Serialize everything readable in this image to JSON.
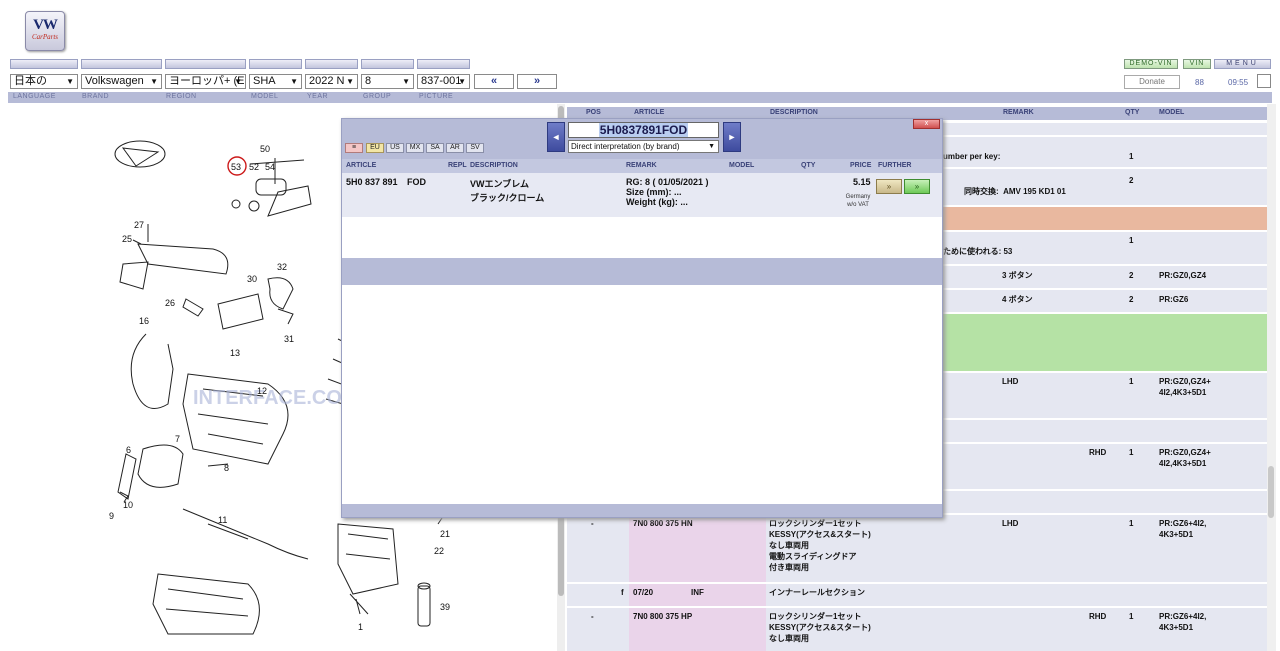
{
  "header": {
    "logo_text": "VW",
    "logo_subtext": "CarParts",
    "demo_vin_label": "DEMO-VIN",
    "vin_label": "VIN",
    "menu_label": "MENU",
    "donate_label": "Donate",
    "counter": "88",
    "time": "09:55"
  },
  "selectors": {
    "language": "日本の",
    "brand": "Volkswagen",
    "region": "ヨーロッパ+ (E",
    "model": "SHA",
    "year": "2022 N",
    "group": "8",
    "picture": "837-001",
    "prev": "«",
    "next": "»"
  },
  "labels": {
    "language": "LANGUAGE",
    "brand": "BRAND",
    "region": "REGION",
    "model": "MODEL",
    "year": "YEAR",
    "group": "GROUP",
    "picture": "PICTURE"
  },
  "diagram": {
    "callouts": [
      "50",
      "53",
      "52",
      "54",
      "27",
      "25",
      "30",
      "32",
      "26",
      "31",
      "16",
      "13",
      "12",
      "7",
      "6",
      "8",
      "10",
      "9",
      "11",
      "21",
      "22",
      "1",
      "39"
    ],
    "watermark": "INTERFACE.CO"
  },
  "table": {
    "headers": {
      "pos": "POS",
      "article": "ARTICLE",
      "description": "DESCRIPTION",
      "remark": "REMARK",
      "qty": "QTY",
      "model": "MODEL"
    },
    "cells": {
      "r1_desc": "umber per key:",
      "r1_qty": "1",
      "r2_qty": "2",
      "r2_desc": "同時交換:  AMV 195 KD1 01",
      "r3_qty": "1",
      "r3_desc": "ために使われる: 53",
      "r4_remark": "3 ボタン",
      "r4_qty": "2",
      "r4_model": "PR:GZ0,GZ4",
      "r5_remark": "4 ボタン",
      "r5_qty": "2",
      "r5_model": "PR:GZ6",
      "r6_remark": "LHD",
      "r6_qty": "1",
      "r6_model": "PR:GZ0,GZ4+\n4I2,4K3+5D1",
      "r7_remark": "RHD",
      "r7_qty": "1",
      "r7_model": "PR:GZ0,GZ4+\n4I2,4K3+5D1",
      "r8_pos": "-",
      "r8_article": "7N0 800 375 HN",
      "r8_desc": "ロックシリンダー1セット\nKESSY(アクセス&スタート)\nなし車両用\n電動スライディングドア\n付き車両用",
      "r8_remark": "LHD",
      "r8_qty": "1",
      "r8_model": "PR:GZ6+4I2,\n4K3+5D1",
      "r9_f": "f",
      "r9_date": "07/20",
      "r9_inf": "INF",
      "r9_desc": "インナーレールセクション",
      "r10_pos": "-",
      "r10_article": "7N0 800 375 HP",
      "r10_desc": "ロックシリンダー1セット\nKESSY(アクセス&スタート)\nなし車両用",
      "r10_remark": "RHD",
      "r10_qty": "1",
      "r10_model": "PR:GZ6+4I2,\n4K3+5D1"
    }
  },
  "popup": {
    "close": "x",
    "prev": "◄",
    "next": "►",
    "search_value": "5H0837891FOD",
    "mode": "Direct interpretation (by brand)",
    "region_buttons": [
      "≡",
      "EU",
      "US",
      "MX",
      "SA",
      "AR",
      "SV"
    ],
    "columns": {
      "article": "ARTICLE",
      "repl": "REPL",
      "description": "DESCRIPTION",
      "remark": "REMARK",
      "model": "MODEL",
      "qty": "QTY",
      "price": "PRICE",
      "further": "FURTHER"
    },
    "result": {
      "article": "5H0 837 891",
      "suffix": "FOD",
      "desc_line1": "VWエンブレム",
      "desc_line2": "ブラック/クローム",
      "remark_line1": "RG: 8 ( 01/05/2021 )",
      "remark_line2": "Size (mm): ...",
      "remark_line3": "Weight (kg): ...",
      "price": "5.15",
      "price_country": "Germany",
      "price_vat": "w/o VAT",
      "further1": "»",
      "further2": "»"
    }
  }
}
